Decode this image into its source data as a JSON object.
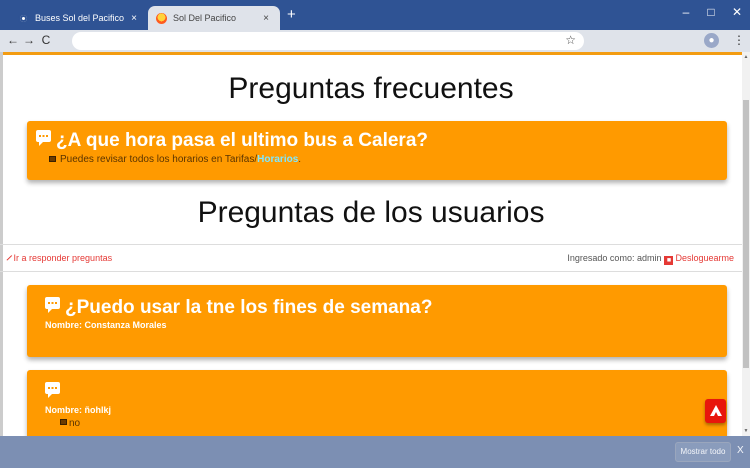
{
  "browser": {
    "tabs": [
      {
        "title": "Buses Sol del Pacifico",
        "active": false,
        "icon": "globe-icon"
      },
      {
        "title": "Sol Del Pacifico",
        "active": true,
        "icon": "sun-logo-icon"
      }
    ],
    "new_tab": "+",
    "window_buttons": [
      "–",
      "□",
      "✕"
    ],
    "nav": [
      "←",
      "→",
      "C"
    ],
    "bookmark_icon": "☆",
    "menu_icon": "⋮",
    "tab_close": "×"
  },
  "page": {
    "faq_title": "Preguntas frecuentes",
    "faq_card": {
      "question": "¿A que hora pasa el ultimo bus a Calera?",
      "answer_prefix": "Puedes revisar todos los horarios en Tarifas/",
      "answer_link": "Horarios",
      "answer_suffix": "."
    },
    "users_title": "Preguntas de los usuarios",
    "reply_link": "Ir a responder preguntas",
    "logged_as": "Ingresado como: admin",
    "logout": "Desloguearme",
    "user_questions": [
      {
        "question": "¿Puedo usar la tne los fines de semana?",
        "name": "Nombre: Constanza Morales"
      },
      {
        "question": "",
        "name": "Nombre: ñohlkj",
        "answer": "no"
      }
    ]
  },
  "download_bar": {
    "show_all": "Mostrar todo",
    "close": "X"
  },
  "colors": {
    "accent": "#ff9a00",
    "chrome": "#2f5394",
    "danger": "#e53935",
    "link_cyan": "#7ee8ff"
  }
}
